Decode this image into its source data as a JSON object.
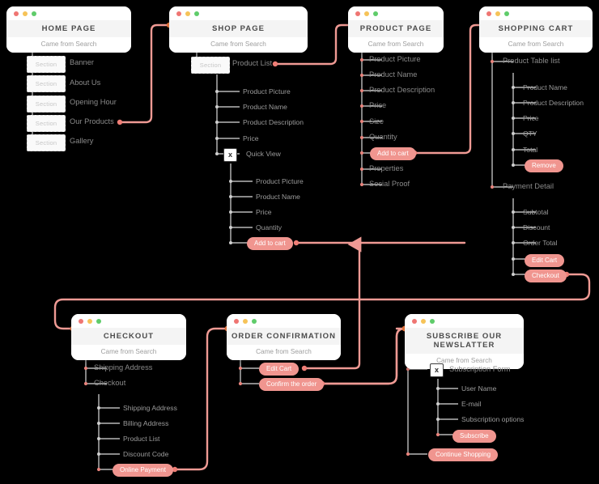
{
  "meta": {
    "colors": {
      "accent": "#f0958f",
      "connector": "#ef9a94",
      "node_dot": "#e8837c",
      "window_title": "#4b4b4b",
      "window_sub": "#9d9d9d",
      "tree_line": "#d9d9d9",
      "background": "#000000"
    },
    "subtitle_common": "Came from Search"
  },
  "windows": {
    "home": {
      "title": "HOME PAGE",
      "subtitle": "Came from Search",
      "sections": [
        {
          "box": "Section",
          "label": "Banner"
        },
        {
          "box": "Section",
          "label": "About Us"
        },
        {
          "box": "Section",
          "label": "Opening Hour"
        },
        {
          "box": "Section",
          "label": "Our Products"
        },
        {
          "box": "Section",
          "label": "Gallery"
        }
      ]
    },
    "shop": {
      "title": "SHOP PAGE",
      "subtitle": "Came from Search",
      "section_box": "Section",
      "section_label": "Product List",
      "items": [
        "Product Picture",
        "Product Name",
        "Product Description",
        "Price"
      ],
      "quick_view": {
        "icon": "x",
        "label": "Quick View",
        "items": [
          "Product Picture",
          "Product Name",
          "Price",
          "Quantity"
        ],
        "button": "Add to cart"
      }
    },
    "product": {
      "title": "PRODUCT PAGE",
      "subtitle": "Came from Search",
      "items_before": [
        "Product Picture",
        "Product Name",
        "Product Description",
        "Price",
        "Size",
        "Quantity"
      ],
      "button": "Add to cart",
      "items_after": [
        "Properties",
        "Social Proof"
      ]
    },
    "cart": {
      "title": "SHOPPING CART",
      "subtitle": "Came from Search",
      "group1_label": "Product Table list",
      "group1_items": [
        "Product Name",
        "Product Description",
        "Price",
        "QTY",
        "Total"
      ],
      "group1_button": "Remove",
      "group2_label": "Payment Detail",
      "group2_items": [
        "Subtotal",
        "Discount",
        "Order Total"
      ],
      "group2_buttons": [
        "Edit Cart",
        "Checkout"
      ]
    },
    "checkout": {
      "title": "CHECKOUT",
      "subtitle": "Came from Search",
      "items": [
        "Shipping Address",
        "Checkout"
      ],
      "sub_items": [
        "Shipping Address",
        "Billing Address",
        "Product List",
        "Discount Code"
      ],
      "button": "Online Payment"
    },
    "confirmation": {
      "title": "ORDER CONFIRMATION",
      "subtitle": "Came from Search",
      "buttons": [
        "Edit Cart",
        "Confirm the order"
      ]
    },
    "newsletter": {
      "title": "SUBSCRIBE OUR NEWSLATTER",
      "subtitle": "Came from Search",
      "form": {
        "icon": "x",
        "label": "Subscription Form",
        "items": [
          "User Name",
          "E-mail",
          "Subscription options"
        ],
        "button": "Subscribe"
      },
      "button": "Continue Shopping"
    }
  }
}
